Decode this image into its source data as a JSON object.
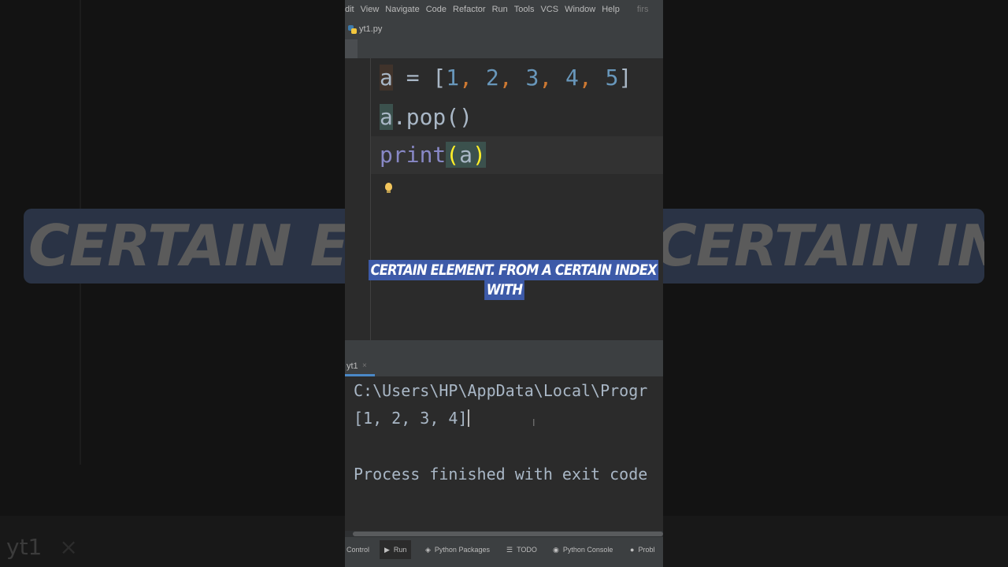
{
  "menu": {
    "items": [
      "dit",
      "View",
      "Navigate",
      "Code",
      "Refactor",
      "Run",
      "Tools",
      "VCS",
      "Window",
      "Help"
    ],
    "project_fragment": "firs"
  },
  "file_tab": {
    "name": "yt1.py"
  },
  "editor": {
    "lines": [
      {
        "segments": [
          {
            "text": "a",
            "cls": "var-hl2"
          },
          {
            "text": " = [",
            "cls": ""
          },
          {
            "text": "1",
            "cls": "num"
          },
          {
            "text": ", ",
            "cls": "pun"
          },
          {
            "text": "2",
            "cls": "num"
          },
          {
            "text": ", ",
            "cls": "pun"
          },
          {
            "text": "3",
            "cls": "num"
          },
          {
            "text": ", ",
            "cls": "pun"
          },
          {
            "text": "4",
            "cls": "num"
          },
          {
            "text": ", ",
            "cls": "pun"
          },
          {
            "text": "5",
            "cls": "num"
          },
          {
            "text": "]",
            "cls": ""
          }
        ]
      },
      {
        "segments": [
          {
            "text": "a",
            "cls": "var-hl"
          },
          {
            "text": ".pop()",
            "cls": ""
          }
        ]
      },
      {
        "segments": [
          {
            "text": "print",
            "cls": "fn"
          },
          {
            "text": "(",
            "cls": "paren-hl"
          },
          {
            "text": "a",
            "cls": "var-hl"
          },
          {
            "text": ")",
            "cls": "paren-hl"
          }
        ]
      }
    ]
  },
  "run_panel": {
    "tab_label": "yt1",
    "close_glyph": "×",
    "console_lines": [
      "C:\\Users\\HP\\AppData\\Local\\Progr",
      "[1, 2, 3, 4]",
      "Process finished with exit code"
    ]
  },
  "tool_windows": [
    {
      "label": "Control",
      "icon": ""
    },
    {
      "label": "Run",
      "icon": "▶"
    },
    {
      "label": "Python Packages",
      "icon": "◈"
    },
    {
      "label": "TODO",
      "icon": "☰"
    },
    {
      "label": "Python Console",
      "icon": "◉"
    },
    {
      "label": "Probl",
      "icon": "●"
    }
  ],
  "caption": {
    "line1": "CERTAIN ELEMENT. FROM A CERTAIN INDEX",
    "line2": "WITH",
    "bg_left": "CERTAIN ELEM",
    "bg_right": "CERTAIN INDEX",
    "bg_tab": "yt1",
    "bg_tab_close": "×"
  },
  "colors": {
    "caption_bg": "#3d5aa8",
    "number": "#6897bb",
    "punct": "#cc7832",
    "builtin": "#8888c6",
    "paren_highlight": "#ffef28",
    "accent": "#4a88c7"
  }
}
